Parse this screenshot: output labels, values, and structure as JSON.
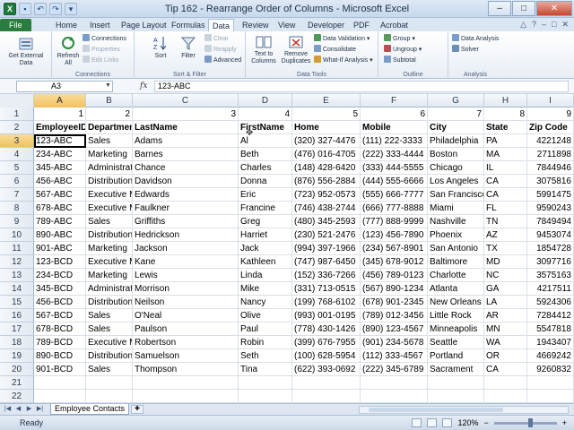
{
  "window": {
    "title": "Tip 162 - Rearrange Order of Columns - Microsoft Excel",
    "controls": [
      "–",
      "□",
      "✕"
    ]
  },
  "ribbon_tabs": [
    "File",
    "Home",
    "Insert",
    "Page Layout",
    "Formulas",
    "Data",
    "Review",
    "View",
    "Developer",
    "PDF",
    "Acrobat"
  ],
  "active_tab": "Data",
  "ribbon": {
    "get_external": {
      "label": "Get External Data"
    },
    "connections": {
      "refresh_all": "Refresh All",
      "connections": "Connections",
      "properties": "Properties",
      "edit_links": "Edit Links",
      "group_label": "Connections"
    },
    "sort_filter": {
      "sort": "Sort",
      "filter": "Filter",
      "clear": "Clear",
      "reapply": "Reapply",
      "advanced": "Advanced",
      "group_label": "Sort & Filter"
    },
    "data_tools": {
      "text_to_columns": "Text to Columns",
      "remove_duplicates": "Remove Duplicates",
      "data_validation": "Data Validation",
      "consolidate": "Consolidate",
      "what_if": "What-If Analysis",
      "group_label": "Data Tools"
    },
    "outline": {
      "group": "Group",
      "ungroup": "Ungroup",
      "subtotal": "Subtotal",
      "group_label": "Outline"
    },
    "analysis": {
      "data_analysis": "Data Analysis",
      "solver": "Solver",
      "group_label": "Analysis"
    }
  },
  "formula_bar": {
    "name_box": "A3",
    "fx": "fx",
    "content": "123-ABC"
  },
  "columns": [
    "A",
    "B",
    "C",
    "D",
    "E",
    "F",
    "G",
    "H",
    "I"
  ],
  "active_column": "A",
  "active_row": 3,
  "rows": [
    {
      "n": "1",
      "cells": [
        "1",
        "2",
        "3",
        "4",
        "5",
        "6",
        "7",
        "8",
        "9"
      ]
    },
    {
      "n": "2",
      "cells": [
        "EmployeeID",
        "Department",
        "LastName",
        "FirstName",
        "Home",
        "Mobile",
        "City",
        "State",
        "Zip Code"
      ]
    },
    {
      "n": "3",
      "cells": [
        "123-ABC",
        "Sales",
        "Adams",
        "Al",
        "(320) 327-4476",
        "(111) 222-3333",
        "Philadelphia",
        "PA",
        "4221248"
      ]
    },
    {
      "n": "4",
      "cells": [
        "234-ABC",
        "Marketing",
        "Barnes",
        "Beth",
        "(476) 016-4705",
        "(222) 333-4444",
        "Boston",
        "MA",
        "2711898"
      ]
    },
    {
      "n": "5",
      "cells": [
        "345-ABC",
        "Administrati",
        "Chance",
        "Charles",
        "(148) 428-6420",
        "(333) 444-5555",
        "Chicago",
        "IL",
        "7844946"
      ]
    },
    {
      "n": "6",
      "cells": [
        "456-ABC",
        "Distribution",
        "Davidson",
        "Donna",
        "(876) 556-2884",
        "(444) 555-6666",
        "Los Angeles",
        "CA",
        "3075816"
      ]
    },
    {
      "n": "7",
      "cells": [
        "567-ABC",
        "Executive M",
        "Edwards",
        "Eric",
        "(723) 952-0573",
        "(555) 666-7777",
        "San Francisco",
        "CA",
        "5991475"
      ]
    },
    {
      "n": "8",
      "cells": [
        "678-ABC",
        "Executive M",
        "Faulkner",
        "Francine",
        "(746) 438-2744",
        "(666) 777-8888",
        "Miami",
        "FL",
        "9590243"
      ]
    },
    {
      "n": "9",
      "cells": [
        "789-ABC",
        "Sales",
        "Griffiths",
        "Greg",
        "(480) 345-2593",
        "(777) 888-9999",
        "Nashville",
        "TN",
        "7849494"
      ]
    },
    {
      "n": "10",
      "cells": [
        "890-ABC",
        "Distribution",
        "Hedrickson",
        "Harriet",
        "(230) 521-2476",
        "(123) 456-7890",
        "Phoenix",
        "AZ",
        "9453074"
      ]
    },
    {
      "n": "11",
      "cells": [
        "901-ABC",
        "Marketing",
        "Jackson",
        "Jack",
        "(994) 397-1966",
        "(234) 567-8901",
        "San Antonio",
        "TX",
        "1854728"
      ]
    },
    {
      "n": "12",
      "cells": [
        "123-BCD",
        "Executive M",
        "Kane",
        "Kathleen",
        "(747) 987-6450",
        "(345) 678-9012",
        "Baltimore",
        "MD",
        "3097716"
      ]
    },
    {
      "n": "13",
      "cells": [
        "234-BCD",
        "Marketing",
        "Lewis",
        "Linda",
        "(152) 336-7266",
        "(456) 789-0123",
        "Charlotte",
        "NC",
        "3575163"
      ]
    },
    {
      "n": "14",
      "cells": [
        "345-BCD",
        "Administrati",
        "Morrison",
        "Mike",
        "(331) 713-0515",
        "(567) 890-1234",
        "Atlanta",
        "GA",
        "4217511"
      ]
    },
    {
      "n": "15",
      "cells": [
        "456-BCD",
        "Distribution",
        "Neilson",
        "Nancy",
        "(199) 768-6102",
        "(678) 901-2345",
        "New Orleans",
        "LA",
        "5924306"
      ]
    },
    {
      "n": "16",
      "cells": [
        "567-BCD",
        "Sales",
        "O'Neal",
        "Olive",
        "(993) 001-0195",
        "(789) 012-3456",
        "Little Rock",
        "AR",
        "7284412"
      ]
    },
    {
      "n": "17",
      "cells": [
        "678-BCD",
        "Sales",
        "Paulson",
        "Paul",
        "(778) 430-1426",
        "(890) 123-4567",
        "Minneapolis",
        "MN",
        "5547818"
      ]
    },
    {
      "n": "18",
      "cells": [
        "789-BCD",
        "Executive M",
        "Robertson",
        "Robin",
        "(399) 676-7955",
        "(901) 234-5678",
        "Seattle",
        "WA",
        "1943407"
      ]
    },
    {
      "n": "19",
      "cells": [
        "890-BCD",
        "Distribution",
        "Samuelson",
        "Seth",
        "(100) 628-5954",
        "(112) 333-4567",
        "Portland",
        "OR",
        "4669242"
      ]
    },
    {
      "n": "20",
      "cells": [
        "901-BCD",
        "Sales",
        "Thompson",
        "Tina",
        "(622) 393-0692",
        "(222) 345-6789",
        "Sacrament",
        "CA",
        "9260832"
      ]
    },
    {
      "n": "21",
      "cells": [
        "",
        "",
        "",
        "",
        "",
        "",
        "",
        "",
        ""
      ]
    },
    {
      "n": "22",
      "cells": [
        "",
        "",
        "",
        "",
        "",
        "",
        "",
        "",
        ""
      ]
    }
  ],
  "sheet_tab": "Employee Contacts",
  "status": {
    "ready": "Ready",
    "zoom": "120%",
    "zoom_minus": "−",
    "zoom_plus": "+"
  },
  "colors": {
    "file_tab": "#2a7d3f",
    "selection_header": "#f1c15f"
  }
}
